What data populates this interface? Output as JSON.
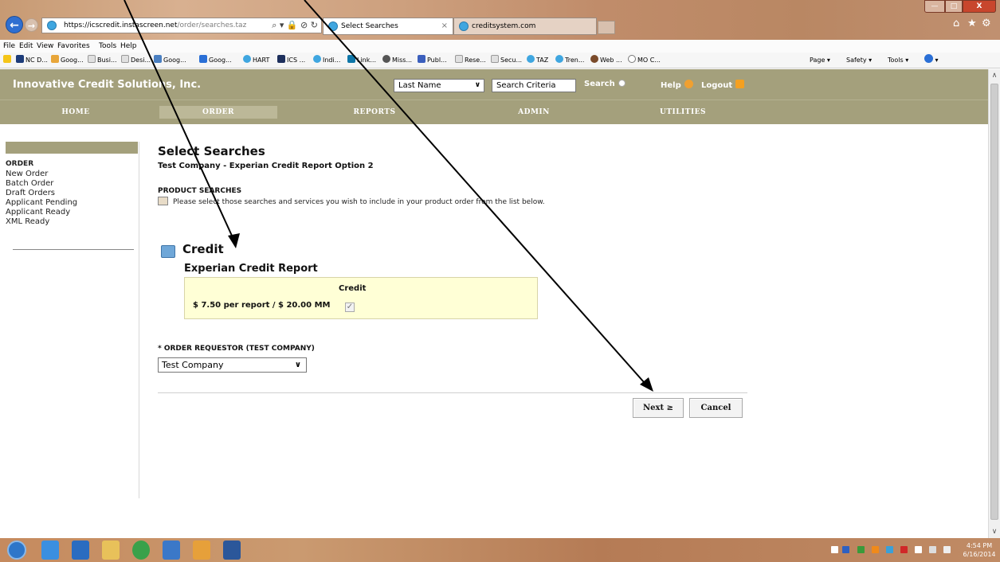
{
  "window": {
    "address_host": "https://icscredit.instascreen.net",
    "address_path": "/order/searches.taz",
    "active_tab": "Select Searches",
    "inactive_tab": "creditsystem.com",
    "controls": {
      "minimize": "—",
      "maximize": "□",
      "close": "X"
    }
  },
  "menu": [
    "File",
    "Edit",
    "View",
    "Favorites",
    "Tools",
    "Help"
  ],
  "favorites": [
    "NC D...",
    "Goog...",
    "Busi...",
    "Desi...",
    "Goog...",
    "Goog...",
    "HART",
    "ICS ...",
    "Indi...",
    "Link...",
    "Miss...",
    "Publ...",
    "Rese...",
    "Secu...",
    "TAZ",
    "Tren...",
    "Web ...",
    "MO C..."
  ],
  "command_bar": {
    "page": "Page ▾",
    "safety": "Safety ▾",
    "tools": "Tools ▾"
  },
  "header": {
    "brand": "Innovative Credit Solutions, Inc.",
    "search_field": "Last Name",
    "search_criteria": "Search Criteria",
    "search": "Search",
    "help": "Help",
    "logout": "Logout"
  },
  "nav": [
    "HOME",
    "ORDER",
    "REPORTS",
    "ADMIN",
    "UTILITIES"
  ],
  "sidebar": {
    "title": "ORDER",
    "items": [
      "New Order",
      "Batch Order",
      "Draft Orders",
      "Applicant Pending",
      "Applicant Ready",
      "XML Ready"
    ]
  },
  "main": {
    "title": "Select Searches",
    "subtitle": "Test Company - Experian Credit Report Option 2",
    "section_heading": "PRODUCT SEARCHES",
    "section_desc": "Please select those searches and services you wish to include in your product order from the list below.",
    "category": "Credit",
    "product_name": "Experian Credit Report",
    "column_label": "Credit",
    "price": "$ 7.50 per report / $ 20.00 MM",
    "checked": true,
    "checkmark": "✓",
    "requestor_label": "* ORDER REQUESTOR (TEST COMPANY)",
    "requestor_value": "Test Company",
    "next": "Next ≥",
    "cancel": "Cancel"
  },
  "taskbar": {
    "time": "4:54 PM",
    "date": "6/16/2014"
  }
}
